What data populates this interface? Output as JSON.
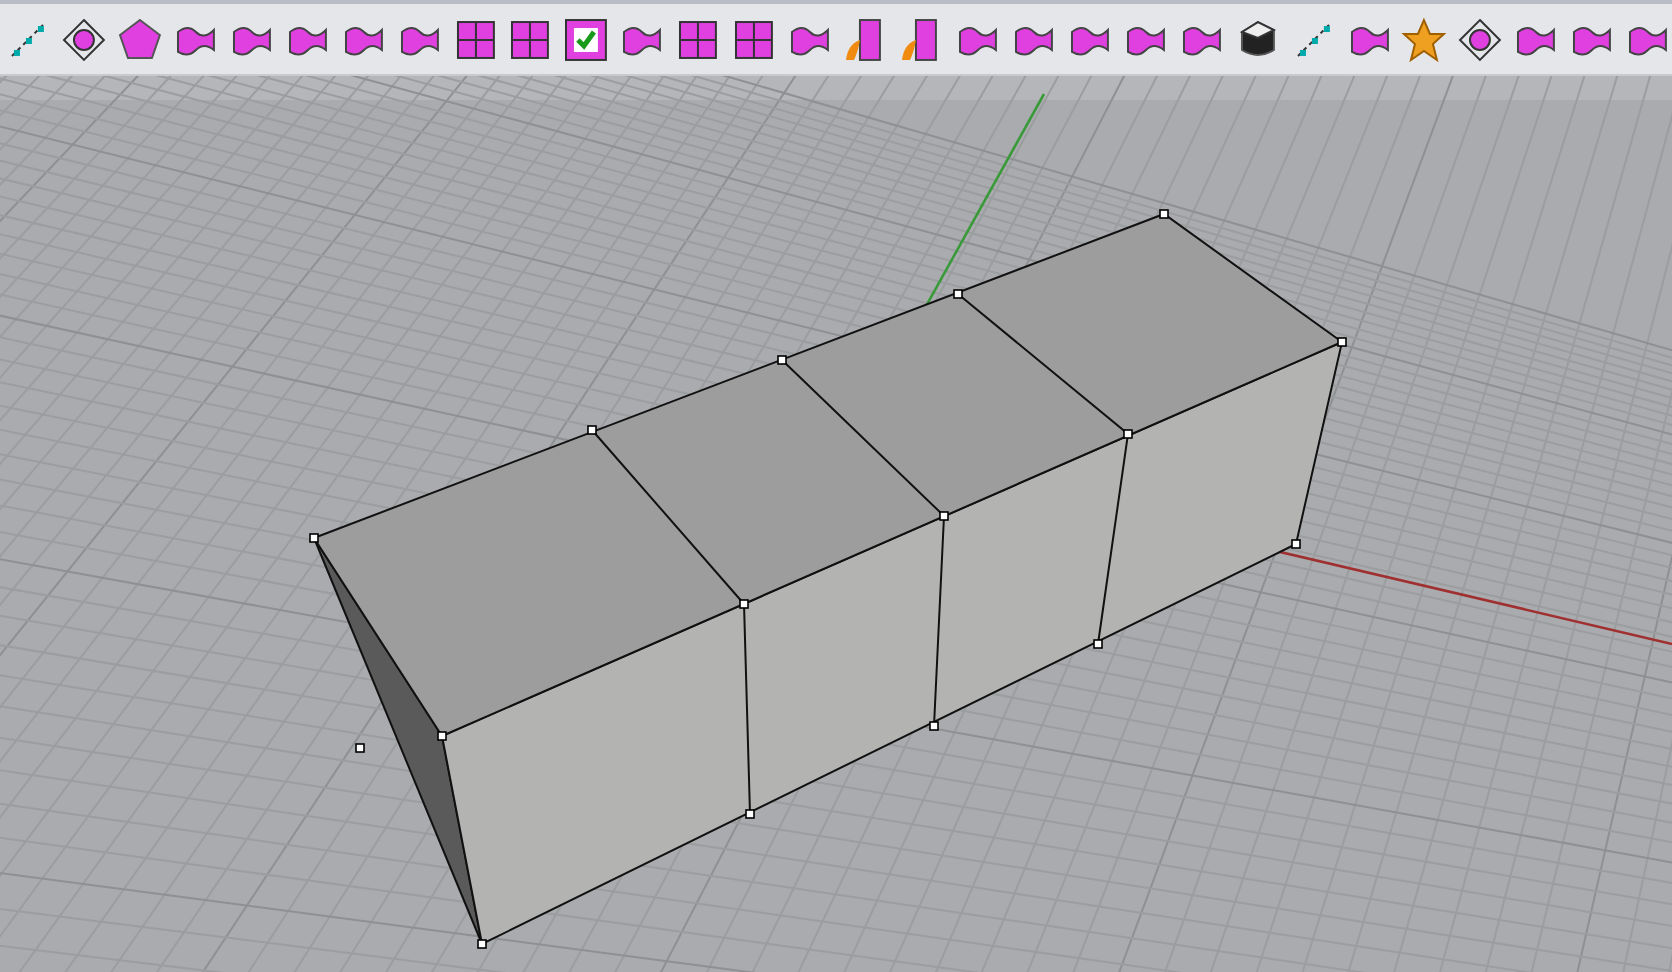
{
  "toolbar": {
    "buttons": [
      {
        "kind": "points"
      },
      {
        "kind": "node"
      },
      {
        "kind": "polygon"
      },
      {
        "kind": "surface"
      },
      {
        "kind": "surface"
      },
      {
        "kind": "surface"
      },
      {
        "kind": "surface"
      },
      {
        "kind": "surface"
      },
      {
        "kind": "grid"
      },
      {
        "kind": "grid"
      },
      {
        "kind": "check"
      },
      {
        "kind": "surface"
      },
      {
        "kind": "grid"
      },
      {
        "kind": "grid"
      },
      {
        "kind": "surface"
      },
      {
        "kind": "pipe"
      },
      {
        "kind": "pipe"
      },
      {
        "kind": "surface"
      },
      {
        "kind": "surface"
      },
      {
        "kind": "surface"
      },
      {
        "kind": "surface"
      },
      {
        "kind": "surface"
      },
      {
        "kind": "solid"
      },
      {
        "kind": "points"
      },
      {
        "kind": "surface"
      },
      {
        "kind": "star"
      },
      {
        "kind": "node"
      },
      {
        "kind": "surface"
      },
      {
        "kind": "surface"
      },
      {
        "kind": "surface"
      }
    ]
  }
}
